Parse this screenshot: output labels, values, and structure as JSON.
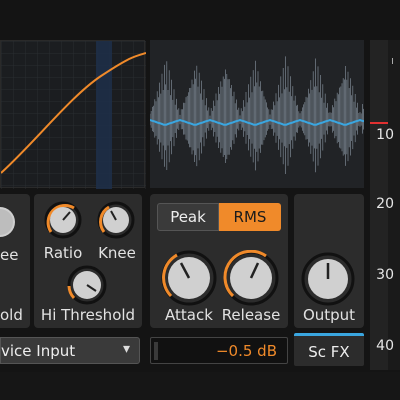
{
  "graph": {
    "curve_color": "#f08a2a"
  },
  "comp1": {
    "labels": [
      "ee",
      "old"
    ]
  },
  "comp2": {
    "ratio": "Ratio",
    "knee": "Knee",
    "hi_threshold": "Hi Threshold"
  },
  "mode": {
    "peak": "Peak",
    "rms": "RMS",
    "selected": "RMS",
    "attack": "Attack",
    "release": "Release"
  },
  "output": {
    "label": "Output"
  },
  "input_select": {
    "value": "vice Input",
    "chevron": "▾"
  },
  "gain_readout": {
    "value": "−0.5 dB"
  },
  "sc_fx": {
    "label": "Sc FX"
  },
  "meter": {
    "ticks": [
      "10",
      "20",
      "30",
      "40"
    ]
  },
  "colors": {
    "accent": "#f08a2a",
    "waveform": "#3aa6e0",
    "meter_red": "#e03030"
  }
}
